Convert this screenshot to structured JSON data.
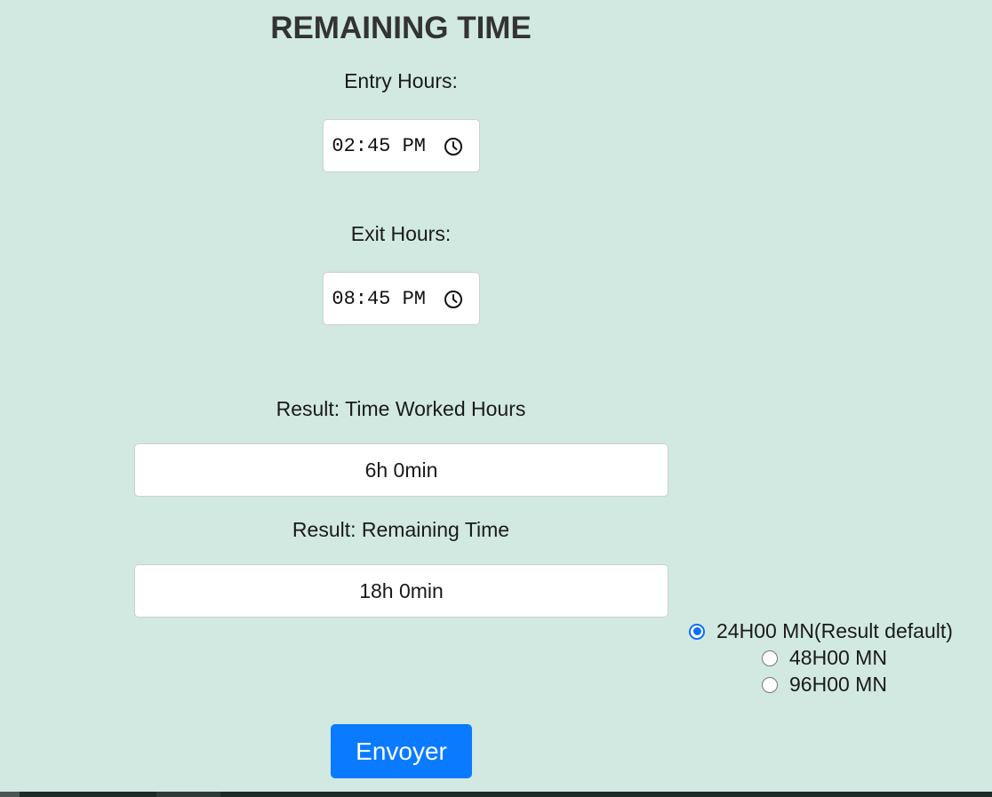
{
  "page": {
    "title": "REMAINING TIME"
  },
  "entry": {
    "label": "Entry Hours:",
    "value": "02:45 PM",
    "icon": "clock-icon"
  },
  "exit": {
    "label": "Exit Hours:",
    "value": "08:45 PM",
    "icon": "clock-icon"
  },
  "result_worked": {
    "label": "Result: Time Worked Hours",
    "value": "6h 0min"
  },
  "result_remaining": {
    "label": "Result: Remaining Time",
    "value": "18h 0min"
  },
  "options": [
    {
      "label": "24H00 MN(Result default)",
      "checked": true
    },
    {
      "label": "48H00 MN",
      "checked": false
    },
    {
      "label": "96H00 MN",
      "checked": false
    }
  ],
  "submit": {
    "label": "Envoyer"
  },
  "colors": {
    "background": "#d1e9e1",
    "accent": "#0a7bff",
    "title": "#333333"
  }
}
